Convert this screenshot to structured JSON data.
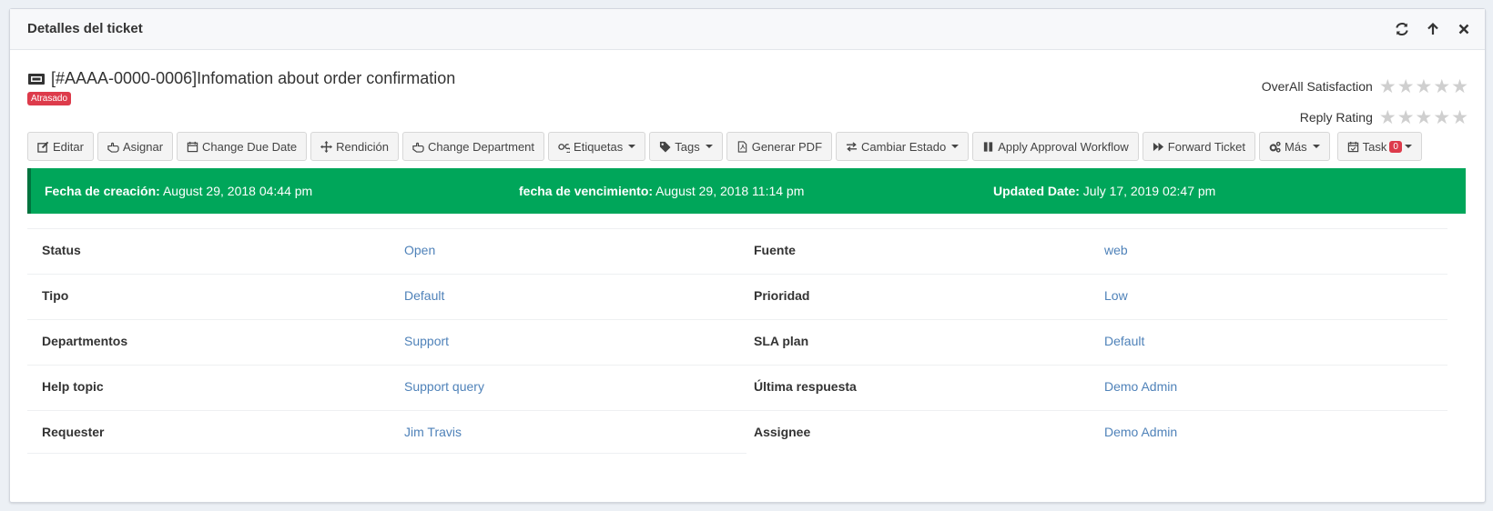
{
  "header": {
    "title": "Detalles del ticket",
    "tools": [
      "refresh-icon",
      "arrow-up-icon",
      "close-icon"
    ]
  },
  "ticket": {
    "title": "[#AAAA-0000-0006]Infomation about order confirmation",
    "status_badge": "Atrasado"
  },
  "ratings": {
    "overall_label": "OverAll Satisfaction",
    "reply_label": "Reply Rating",
    "overall_stars": 0,
    "reply_stars": 0,
    "max_stars": 5
  },
  "toolbar": {
    "buttons": [
      {
        "label": "Editar",
        "icon": "edit-icon"
      },
      {
        "label": "Asignar",
        "icon": "hand-pointer-icon"
      },
      {
        "label": "Change Due Date",
        "icon": "calendar-icon"
      },
      {
        "label": "Rendición",
        "icon": "move-icon"
      },
      {
        "label": "Change Department",
        "icon": "hand-pointer-icon"
      },
      {
        "label": "Etiquetas",
        "icon": "label-icon",
        "dropdown": true
      },
      {
        "label": "Tags",
        "icon": "tag-icon",
        "dropdown": true
      },
      {
        "label": "Generar PDF",
        "icon": "pdf-icon"
      },
      {
        "label": "Cambiar Estado",
        "icon": "exchange-icon",
        "dropdown": true
      },
      {
        "label": "Apply Approval Workflow",
        "icon": "pause-icon"
      },
      {
        "label": "Forward Ticket",
        "icon": "forward-icon"
      },
      {
        "label": "Más",
        "icon": "gears-icon",
        "dropdown": true
      },
      {
        "label": "Task",
        "icon": "calendar-check-icon",
        "dropdown": true,
        "badge": "0"
      }
    ]
  },
  "dates": {
    "created_label": "Fecha de creación:",
    "created_value": "August 29, 2018 04:44 pm",
    "due_label": "fecha de vencimiento:",
    "due_value": "August 29, 2018 11:14 pm",
    "updated_label": "Updated Date:",
    "updated_value": "July 17, 2019 02:47 pm"
  },
  "details": {
    "left": [
      {
        "label": "Status",
        "value": "Open"
      },
      {
        "label": "Tipo",
        "value": "Default"
      },
      {
        "label": "Departmentos",
        "value": "Support"
      },
      {
        "label": "Help topic",
        "value": "Support query"
      },
      {
        "label": "Requester",
        "value": "Jim Travis"
      }
    ],
    "right": [
      {
        "label": "Fuente",
        "value": "web"
      },
      {
        "label": "Prioridad",
        "value": "Low"
      },
      {
        "label": "SLA plan",
        "value": "Default"
      },
      {
        "label": "Última respuesta",
        "value": "Demo Admin"
      },
      {
        "label": "Assignee",
        "value": "Demo Admin"
      }
    ]
  },
  "colors": {
    "dates_bar": "#00a65a",
    "link": "#4f82b9",
    "badge": "#dd3b4b"
  }
}
